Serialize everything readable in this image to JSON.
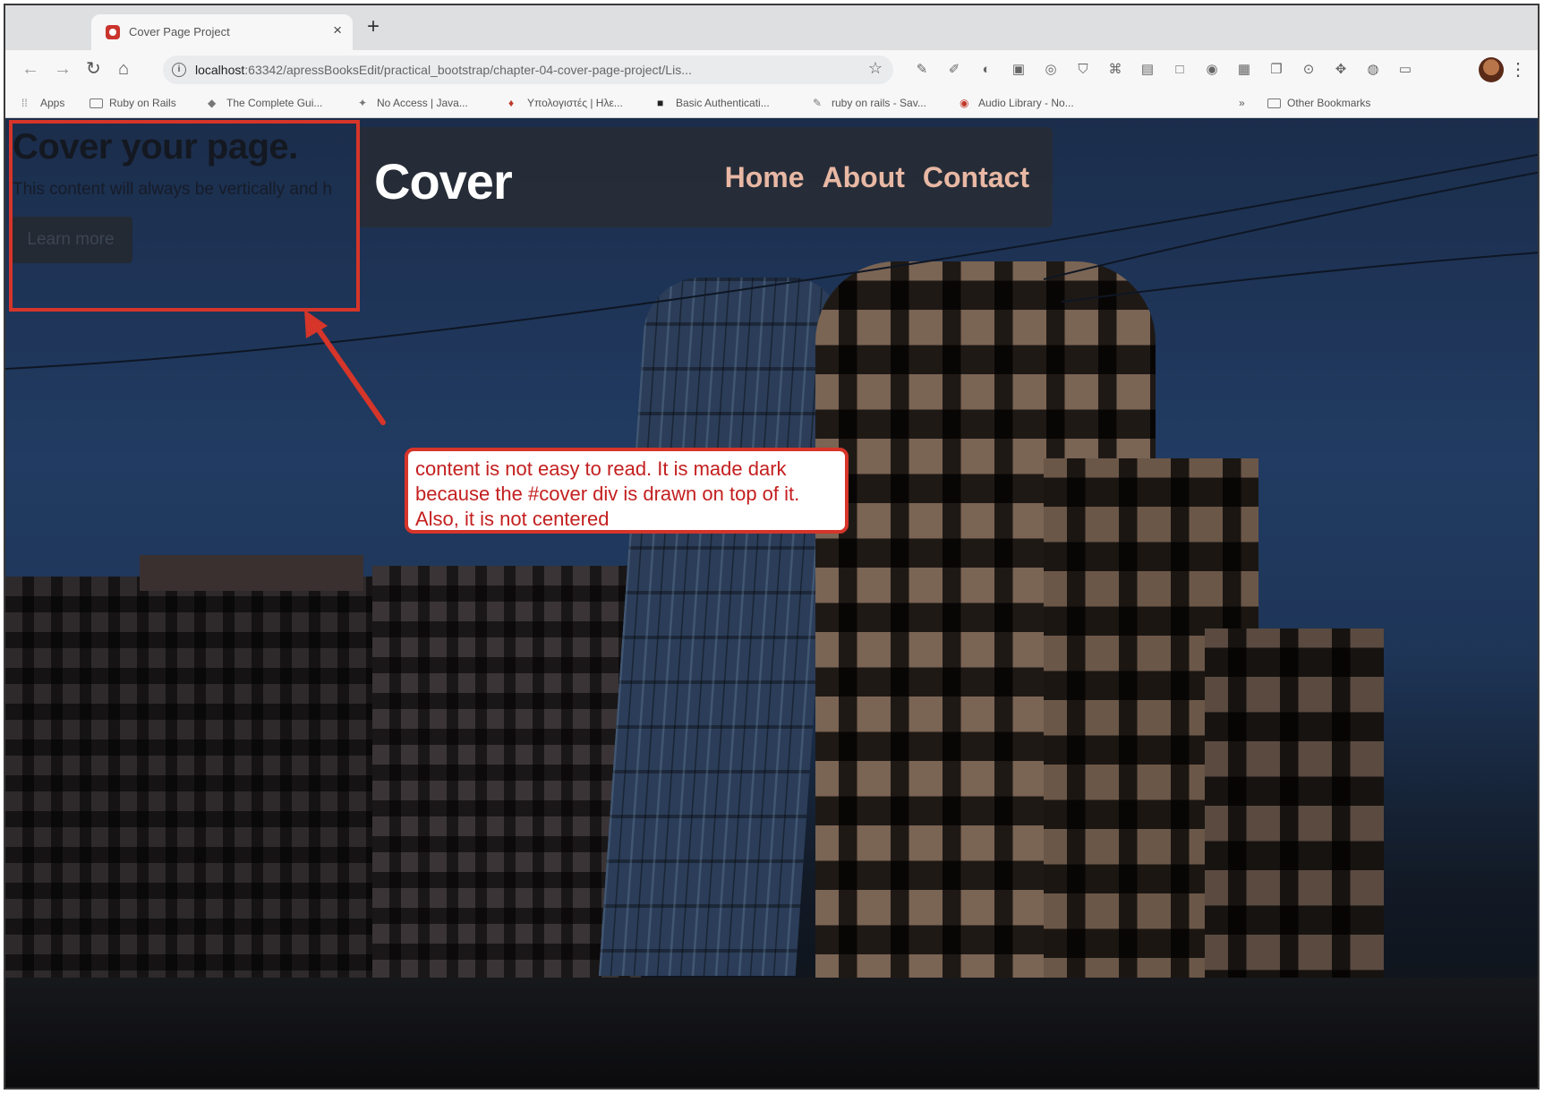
{
  "browser": {
    "tab": {
      "title": "Cover Page Project",
      "close": "×"
    },
    "new_tab": "+",
    "url_host": "localhost",
    "url_rest": ":63342/apressBooksEdit/practical_bootstrap/chapter-04-cover-page-project/Lis...",
    "bookmarks": [
      {
        "label": "Apps",
        "icon": "apps-grid-icon"
      },
      {
        "label": "Ruby on Rails",
        "icon": "folder-icon"
      },
      {
        "label": "The Complete Gui...",
        "icon": "site-icon"
      },
      {
        "label": "No Access | Java...",
        "icon": "site-icon"
      },
      {
        "label": "Υπολογιστές | Ηλε...",
        "icon": "site-icon"
      },
      {
        "label": "Basic Authenticati...",
        "icon": "site-icon"
      },
      {
        "label": "ruby on rails - Sav...",
        "icon": "site-icon"
      },
      {
        "label": "Audio Library - No...",
        "icon": "site-icon"
      },
      {
        "label": "»",
        "icon": ""
      },
      {
        "label": "Other Bookmarks",
        "icon": "folder-icon"
      }
    ]
  },
  "page": {
    "hero_title": "Cover your page.",
    "hero_text": "This content will always be vertically and h",
    "learn_more": "Learn more",
    "brand": "Cover",
    "nav": [
      "Home",
      "About",
      "Contact"
    ]
  },
  "annotation": {
    "callout": "content is not easy to read. It is made dark because the #cover div is drawn on top of it. Also, it is not centered"
  },
  "colors": {
    "annotation_red": "#d6352a",
    "nav_link": "#e8b8a4",
    "overlay": "#282c34"
  }
}
